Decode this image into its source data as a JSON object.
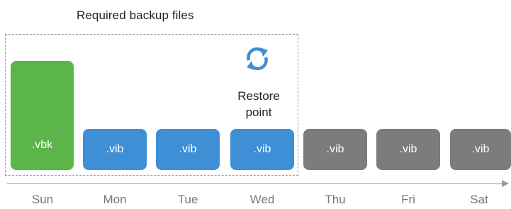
{
  "title": "Required backup files",
  "restore_point": {
    "label_line1": "Restore",
    "label_line2": "point",
    "icon": "refresh-icon",
    "icon_color": "#3f8fd6"
  },
  "colors": {
    "full_backup": "#5bb548",
    "incremental_required": "#3f8fd6",
    "incremental_not_required": "#7c7c7c",
    "axis": "#9a9a9a"
  },
  "files": [
    {
      "label": ".vbk",
      "day": "Sun",
      "type": "full",
      "required": true
    },
    {
      "label": ".vib",
      "day": "Mon",
      "type": "incremental",
      "required": true
    },
    {
      "label": ".vib",
      "day": "Tue",
      "type": "incremental",
      "required": true
    },
    {
      "label": ".vib",
      "day": "Wed",
      "type": "incremental",
      "required": true
    },
    {
      "label": ".vib",
      "day": "Thu",
      "type": "incremental",
      "required": false
    },
    {
      "label": ".vib",
      "day": "Fri",
      "type": "incremental",
      "required": false
    },
    {
      "label": ".vib",
      "day": "Sat",
      "type": "incremental",
      "required": false
    }
  ]
}
